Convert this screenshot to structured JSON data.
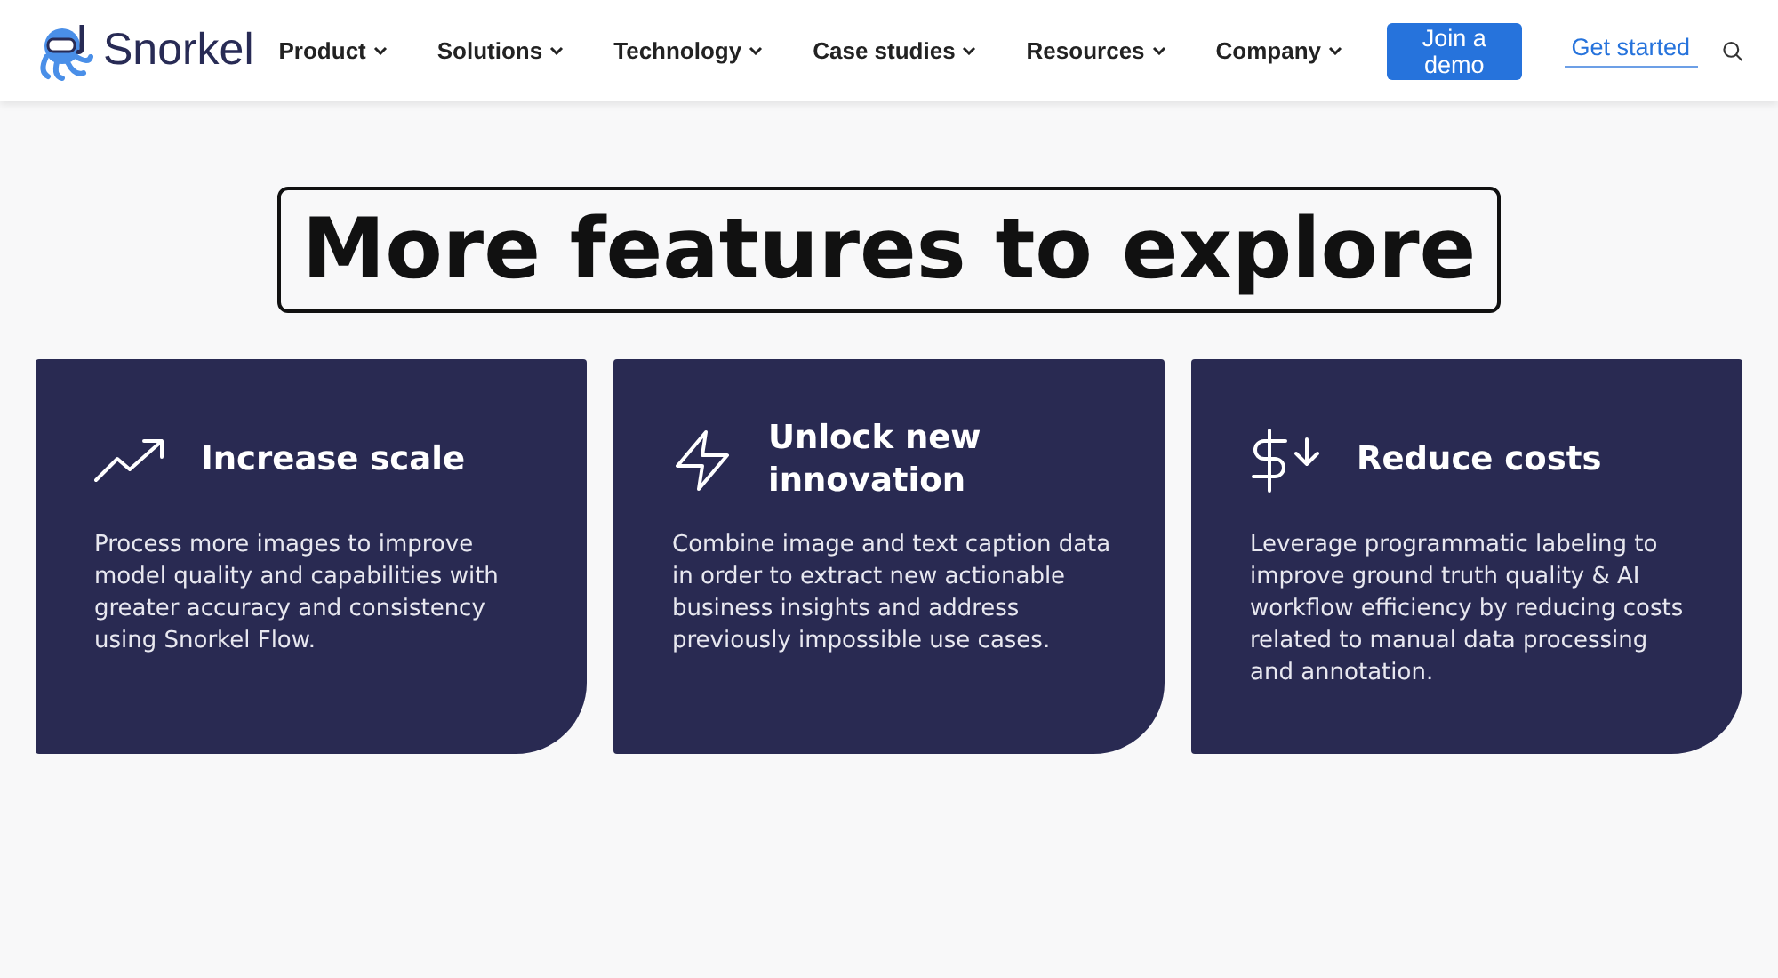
{
  "header": {
    "logo_text": "Snorkel",
    "nav": [
      {
        "label": "Product"
      },
      {
        "label": "Solutions"
      },
      {
        "label": "Technology"
      },
      {
        "label": "Case studies"
      },
      {
        "label": "Resources"
      },
      {
        "label": "Company"
      }
    ],
    "demo_button": "Join a demo",
    "start_link": "Get started"
  },
  "heading": "More features to explore",
  "features": [
    {
      "kind": "trend",
      "title": "Increase scale",
      "text": "Process more images to improve model quality and capabilities with greater accuracy and consistency using Snorkel Flow."
    },
    {
      "kind": "bolt",
      "title": "Unlock new innovation",
      "text": "Combine image and text caption data in order to extract new actionable business insights and address previously impossible use cases."
    },
    {
      "kind": "dollar",
      "title": "Reduce costs",
      "text": "Leverage programmatic labeling to improve ground truth quality & AI workflow efficiency by reducing costs related to manual data processing and annotation."
    }
  ]
}
